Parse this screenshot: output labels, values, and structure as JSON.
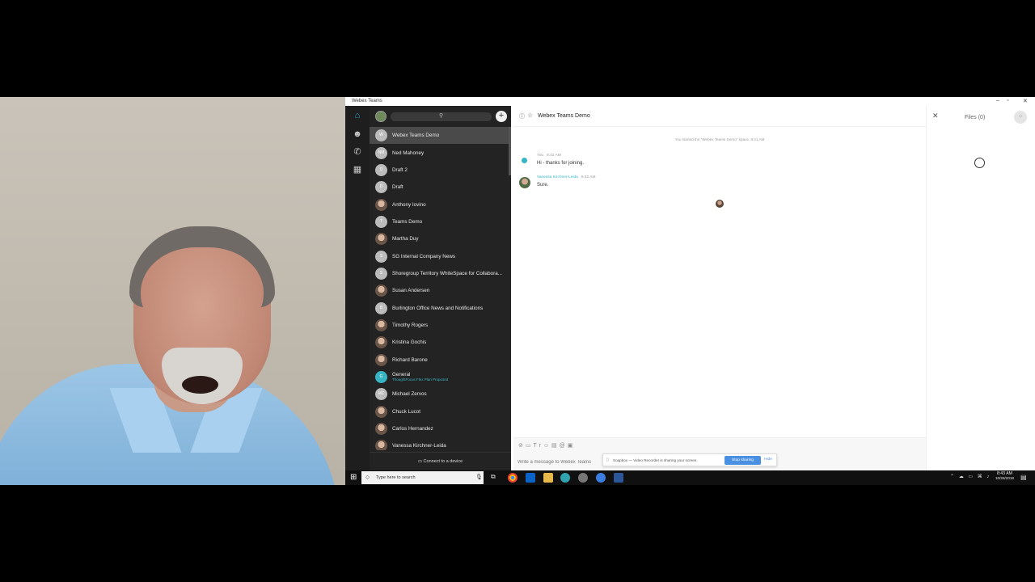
{
  "window": {
    "title": "Webex Teams"
  },
  "spaces": {
    "search_placeholder": "",
    "items": [
      {
        "initial": "W",
        "name": "Webex Teams Demo",
        "selected": true,
        "avatar": "letter"
      },
      {
        "initial": "NM",
        "name": "Ned Mahoney",
        "avatar": "letter"
      },
      {
        "initial": "D",
        "name": "Draft 2",
        "avatar": "letter"
      },
      {
        "initial": "D",
        "name": "Draft",
        "avatar": "letter"
      },
      {
        "initial": "",
        "name": "Anthony Iovino",
        "avatar": "photo"
      },
      {
        "initial": "T",
        "name": "Teams Demo",
        "avatar": "letter"
      },
      {
        "initial": "",
        "name": "Martha Duy",
        "avatar": "photo"
      },
      {
        "initial": "S",
        "name": "SG Internal Company News",
        "avatar": "letter"
      },
      {
        "initial": "S",
        "name": "Shoregroup Territory WhiteSpace for Collabora...",
        "avatar": "letter"
      },
      {
        "initial": "",
        "name": "Susan Andersen",
        "avatar": "photo"
      },
      {
        "initial": "B",
        "name": "Burlington Office News and Notifications",
        "avatar": "letter"
      },
      {
        "initial": "",
        "name": "Timothy Rogers",
        "avatar": "photo"
      },
      {
        "initial": "",
        "name": "Kristina Gochis",
        "avatar": "photo"
      },
      {
        "initial": "",
        "name": "Richard Barone",
        "avatar": "photo"
      },
      {
        "initial": "G",
        "name": "General",
        "sub": "ThoughtFocus Flex Plan Proposed",
        "avatar": "teal"
      },
      {
        "initial": "MZ",
        "name": "Michael Zervos",
        "avatar": "letter"
      },
      {
        "initial": "",
        "name": "Chuck Lucot",
        "avatar": "photo"
      },
      {
        "initial": "",
        "name": "Carlos Hernandez",
        "avatar": "photo"
      },
      {
        "initial": "",
        "name": "Vanessa Kirchner-Leida",
        "avatar": "photo"
      }
    ],
    "connect_label": "Connect to a device"
  },
  "conversation": {
    "title": "Webex Teams Demo",
    "space_start": "You started the \"Webex Teams Demo\" space. 8:41 AM",
    "messages": [
      {
        "sender": "You",
        "time": "8:42 AM",
        "text": "Hi - thanks for joining."
      },
      {
        "sender": "Vanessa Kirchner-Leida",
        "time": "8:42 AM",
        "text": "Sure."
      }
    ],
    "composer_placeholder": "Write a message to Webex Teams"
  },
  "sharing": {
    "text": "Soapbox — Video Recorder is sharing your screen.",
    "stop_label": "Stop sharing",
    "hide_label": "Hide"
  },
  "files_panel": {
    "title": "Files (0)"
  },
  "taskbar": {
    "search_placeholder": "Type here to search",
    "time": "8:43 AM",
    "date": "10/26/2018"
  },
  "colors": {
    "accent": "#37b5c4",
    "rail_bg": "#1e1e1e",
    "list_bg": "#232323",
    "stop_button": "#4a90e2"
  }
}
